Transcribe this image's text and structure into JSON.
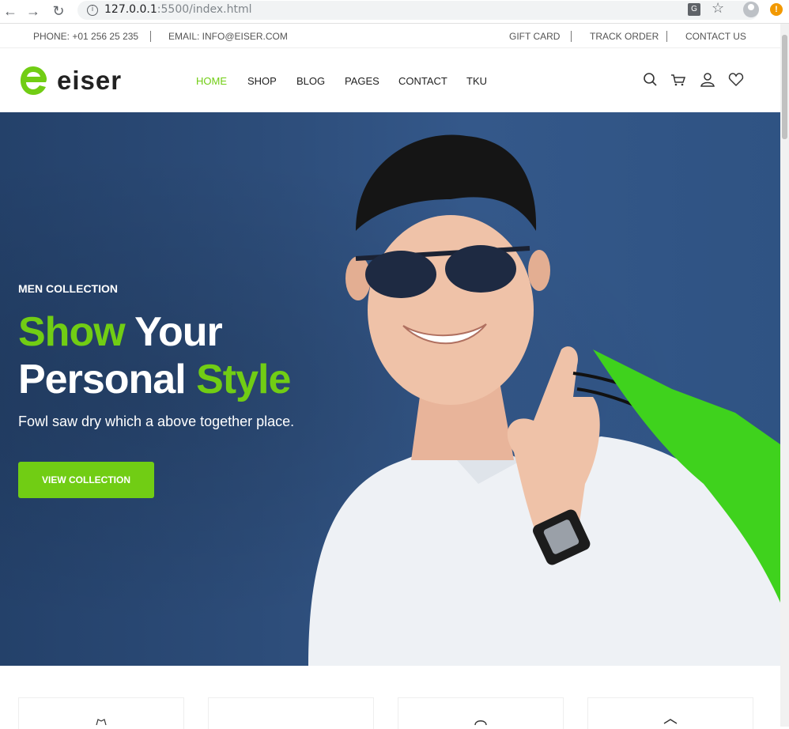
{
  "browser": {
    "url_host": "127.0.0.1",
    "url_rest": ":5500/index.html"
  },
  "topbar": {
    "phone": "PHONE: +01 256 25 235",
    "email": "EMAIL: INFO@EISER.COM",
    "links": [
      "GIFT CARD",
      "TRACK ORDER",
      "CONTACT US"
    ]
  },
  "header": {
    "logo_text": "eiser",
    "nav": [
      "HOME",
      "SHOP",
      "BLOG",
      "PAGES",
      "CONTACT",
      "TKU"
    ],
    "active_nav": "HOME",
    "icons": [
      "search-icon",
      "cart-icon",
      "user-icon",
      "heart-icon"
    ]
  },
  "hero": {
    "subtitle": "MEN COLLECTION",
    "title_line1_green": "Show",
    "title_line1_white": " Your",
    "title_line2_white": "Personal ",
    "title_line2_green": "Style",
    "description": "Fowl saw dry which a above together place.",
    "button": "VIEW COLLECTION"
  },
  "colors": {
    "accent": "#71cd14",
    "hero_bg": "#2d4d7a",
    "text_dark": "#222222"
  }
}
